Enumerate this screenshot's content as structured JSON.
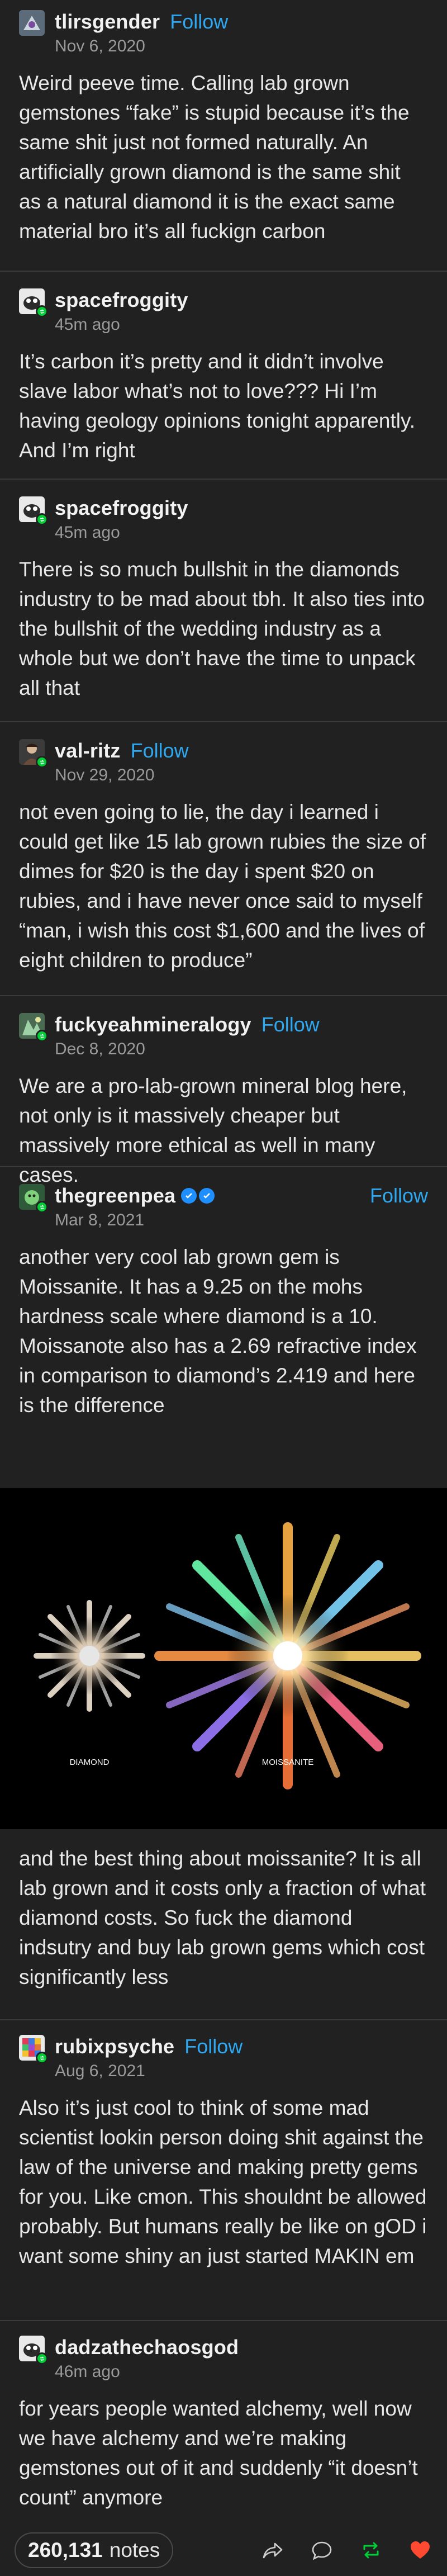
{
  "posts": [
    {
      "username": "tlirsgender",
      "follow": "Follow",
      "time": "Nov 6, 2020",
      "text": "Weird peeve time. Calling lab grown gemstones “fake” is stupid because it’s the same shit just not formed naturally. An artificially grown diamond is the same shit as a natural diamond it is the exact same material bro it’s all fuckign carbon"
    },
    {
      "username": "spacefroggity",
      "time": "45m ago",
      "text": "It’s carbon it’s pretty and it didn’t involve slave labor what’s not to love??? Hi I’m having geology opinions tonight apparently. And I’m right"
    },
    {
      "username": "spacefroggity",
      "time": "45m ago",
      "text": "There is so much bullshit in the diamonds industry to be mad about tbh. It also ties into the bullshit of the wedding industry as a whole but we don’t have the time to unpack all that"
    },
    {
      "username": "val-ritz",
      "follow": "Follow",
      "time": "Nov 29, 2020",
      "text": "not even going to lie, the day i learned i could get like 15 lab grown rubies the size of dimes for $20 is the day i spent $20 on rubies, and i have never once said to myself “man, i wish this cost $1,600 and the lives of eight children to produce”"
    },
    {
      "username": "fuckyeahmineralogy",
      "follow": "Follow",
      "time": "Dec 8, 2020",
      "text": "We are a pro-lab-grown mineral blog here, not only is it massively cheaper but massively more ethical as well in many cases."
    },
    {
      "username": "thegreenpea",
      "follow": "Follow",
      "time": "Mar 8, 2021",
      "text": "another very cool lab grown gem is Moissanite. It has a 9.25 on the mohs hardness scale where diamond is a 10. Moissanote also has a 2.69 refractive index in comparison to diamond’s 2.419 and here is the difference",
      "image_labels": {
        "left": "DIAMOND",
        "right": "MOISSANITE"
      },
      "text_after": "and the best thing about moissanite? It is all lab grown and it costs only a fraction of what diamond costs. So fuck the diamond indsutry and buy lab grown gems which cost significantly less"
    },
    {
      "username": "rubixpsyche",
      "follow": "Follow",
      "time": "Aug 6, 2021",
      "text": "Also it’s just cool to think of some mad scientist lookin person doing shit against the law of the universe and making pretty gems for you. Like cmon. This shouldnt be allowed probably. But humans really be like on gOD i want some shiny an just started MAKIN em"
    },
    {
      "username": "dadzathechaosgod",
      "time": "46m ago",
      "text": "for years people wanted alchemy, well now we have alchemy and we’re making gemstones out of it and suddenly “it doesn’t count” anymore"
    }
  ],
  "footer": {
    "notes_count": "260,131",
    "notes_label": "notes"
  },
  "colors": {
    "background": "#212121",
    "follow": "#2ea8f0",
    "reblog_green": "#00cf35",
    "like_red": "#ff4930"
  },
  "icons": [
    "reblog-icon",
    "verified-badge-icon",
    "share-icon",
    "reply-icon",
    "reblog-icon",
    "heart-icon"
  ]
}
